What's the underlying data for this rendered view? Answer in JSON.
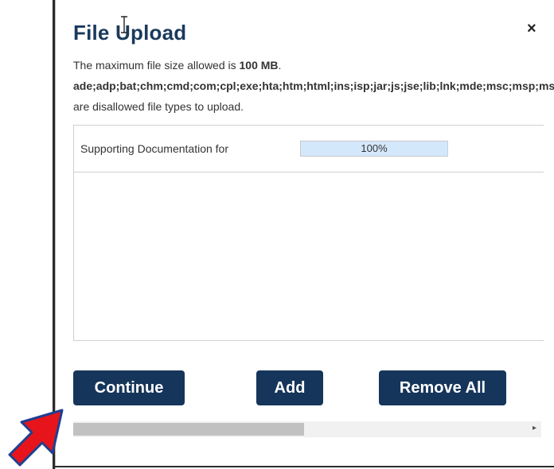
{
  "dialog": {
    "title": "File Upload",
    "close_label": "×",
    "size_prefix": "The maximum file size allowed is ",
    "size_value": "100 MB",
    "size_suffix": ".",
    "disallowed_types": "ade;adp;bat;chm;cmd;com;cpl;exe;hta;htm;html;ins;isp;jar;js;jse;lib;lnk;mde;msc;msp;mst;pif;scr;sct;shb;sys;vb;vbe;vbs;vxd;wsc;wsf;wsh",
    "disallowed_note": "are disallowed file types to upload."
  },
  "files": [
    {
      "name": "Supporting Documentation for",
      "progress_text": "100%",
      "progress_percent": 100
    }
  ],
  "buttons": {
    "continue": "Continue",
    "add": "Add",
    "remove_all": "Remove All"
  },
  "scrollbar": {
    "arrow": "▸"
  },
  "colors": {
    "title": "#1a3a5c",
    "button_bg": "#15355a",
    "progress_fill": "#d4e8fb",
    "annotation_arrow": "#e8141b"
  },
  "icons": {
    "cursor": "text-cursor-icon",
    "annotation": "red-arrow-icon"
  }
}
